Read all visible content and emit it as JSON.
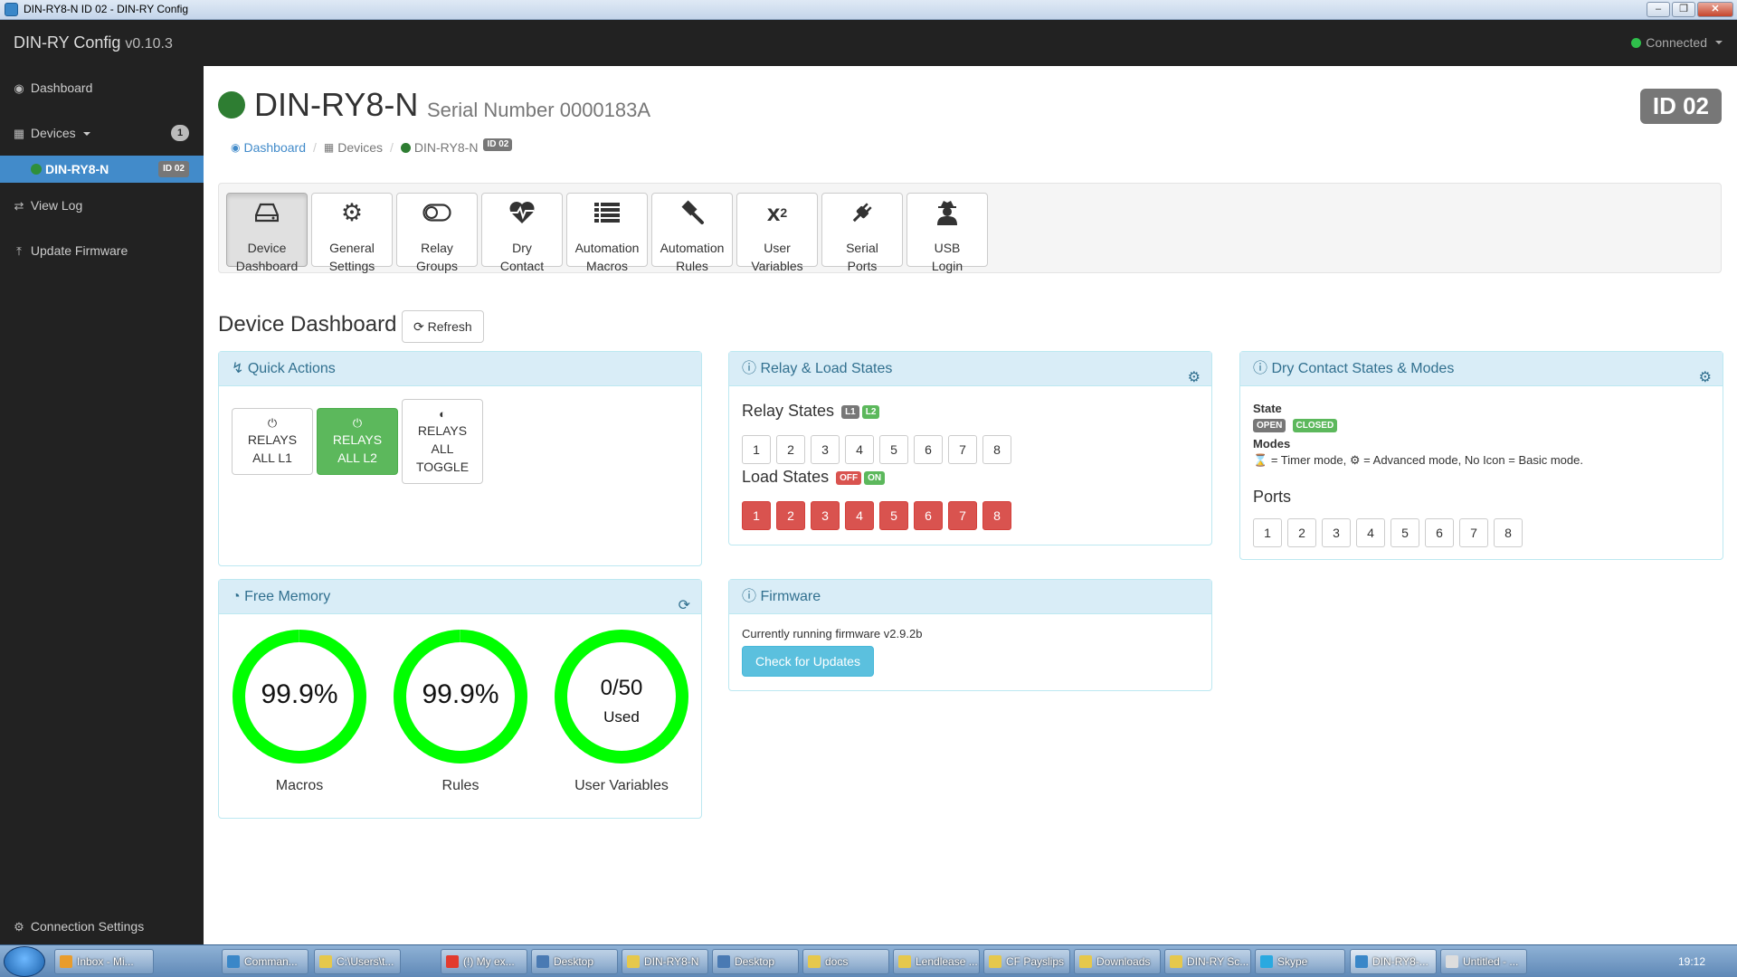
{
  "window": {
    "title": "DIN-RY8-N ID 02 - DIN-RY Config"
  },
  "navbar": {
    "brand": "DIN-RY Config",
    "version": "v0.10.3",
    "status": "Connected",
    "status_color": "#2fbf4b"
  },
  "sidebar": {
    "dashboard": "Dashboard",
    "devices": "Devices",
    "devices_count": "1",
    "device_name": "DIN-RY8-N",
    "device_id": "ID 02",
    "view_log": "View Log",
    "update_firmware": "Update Firmware",
    "connection_settings": "Connection Settings"
  },
  "header": {
    "title": "DIN-RY8-N",
    "serial": "Serial Number 0000183A",
    "id_badge": "ID 02",
    "status_color": "#2e7d32"
  },
  "breadcrumb": {
    "dashboard": "Dashboard",
    "devices": "Devices",
    "device": "DIN-RY8-N",
    "device_id": "ID 02"
  },
  "toolbar": [
    {
      "line1": "Device",
      "line2": "Dashboard",
      "icon": "drive-icon"
    },
    {
      "line1": "General",
      "line2": "Settings",
      "icon": "gear-icon"
    },
    {
      "line1": "Relay",
      "line2": "Groups",
      "icon": "toggle-icon"
    },
    {
      "line1": "Dry",
      "line2": "Contact",
      "icon": "heartbeat-icon"
    },
    {
      "line1": "Automation",
      "line2": "Macros",
      "icon": "list-icon"
    },
    {
      "line1": "Automation",
      "line2": "Rules",
      "icon": "gavel-icon"
    },
    {
      "line1": "User",
      "line2": "Variables",
      "icon": "superscript-icon"
    },
    {
      "line1": "Serial",
      "line2": "Ports",
      "icon": "plug-icon"
    },
    {
      "line1": "USB",
      "line2": "Login",
      "icon": "user-secret-icon"
    }
  ],
  "section": {
    "title": "Device Dashboard",
    "refresh": "Refresh"
  },
  "quick_actions": {
    "title": "Quick Actions",
    "buttons": [
      {
        "label": "RELAYS ALL L1"
      },
      {
        "label": "RELAYS ALL L2"
      },
      {
        "label": "RELAYS ALL TOGGLE"
      }
    ]
  },
  "relay_states": {
    "title": "Relay & Load States",
    "relay_heading": "Relay States",
    "relay_labels": [
      "L1",
      "L2"
    ],
    "relays": [
      "1",
      "2",
      "3",
      "4",
      "5",
      "6",
      "7",
      "8"
    ],
    "load_heading": "Load States",
    "load_labels": [
      "OFF",
      "ON"
    ],
    "loads": [
      "1",
      "2",
      "3",
      "4",
      "5",
      "6",
      "7",
      "8"
    ]
  },
  "dry_contact": {
    "title": "Dry Contact States & Modes",
    "state_heading": "State",
    "state_labels": [
      "OPEN",
      "CLOSED"
    ],
    "modes_heading": "Modes",
    "modes_text_a": "= Timer mode,",
    "modes_text_b": "= Advanced mode, No Icon = Basic mode.",
    "ports_heading": "Ports",
    "ports": [
      "1",
      "2",
      "3",
      "4",
      "5",
      "6",
      "7",
      "8"
    ]
  },
  "free_memory": {
    "title": "Free Memory",
    "ring_color": "#00ff00",
    "gauges": [
      {
        "value": "99.9%",
        "caption": "Macros",
        "fraction": 0.999
      },
      {
        "value": "99.9%",
        "caption": "Rules",
        "fraction": 0.999
      },
      {
        "value": "0/50",
        "sub": "Used",
        "caption": "User Variables",
        "fraction": 1.0
      }
    ]
  },
  "firmware": {
    "title": "Firmware",
    "text": "Currently running firmware v2.9.2b",
    "button": "Check for Updates"
  },
  "taskbar": {
    "items": [
      "Inbox - Mi...",
      "Comman...",
      "C:\\Users\\t...",
      "(!) My ex...",
      "Desktop",
      "DIN-RY8-N",
      "Desktop",
      "docs",
      "Lendlease ...",
      "CF Payslips",
      "Downloads",
      "DIN-RY Sc...",
      "Skype",
      "DIN-RY8-...",
      "Untitled - ..."
    ],
    "clock": "19:12"
  }
}
